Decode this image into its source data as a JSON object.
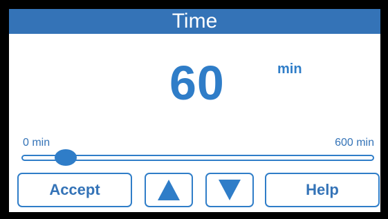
{
  "header": {
    "title": "Time"
  },
  "value_display": {
    "value": "60",
    "unit": "min"
  },
  "slider": {
    "min_label": "0 min",
    "max_label": "600 min",
    "current_value_min": 60
  },
  "buttons": {
    "accept_label": "Accept",
    "help_label": "Help",
    "up_icon": "up-arrow-icon",
    "down_icon": "down-arrow-icon"
  },
  "colors": {
    "accent": "#2f7dc8",
    "title_bar": "#3473b7",
    "background": "#ffffff",
    "bezel": "#000000"
  }
}
